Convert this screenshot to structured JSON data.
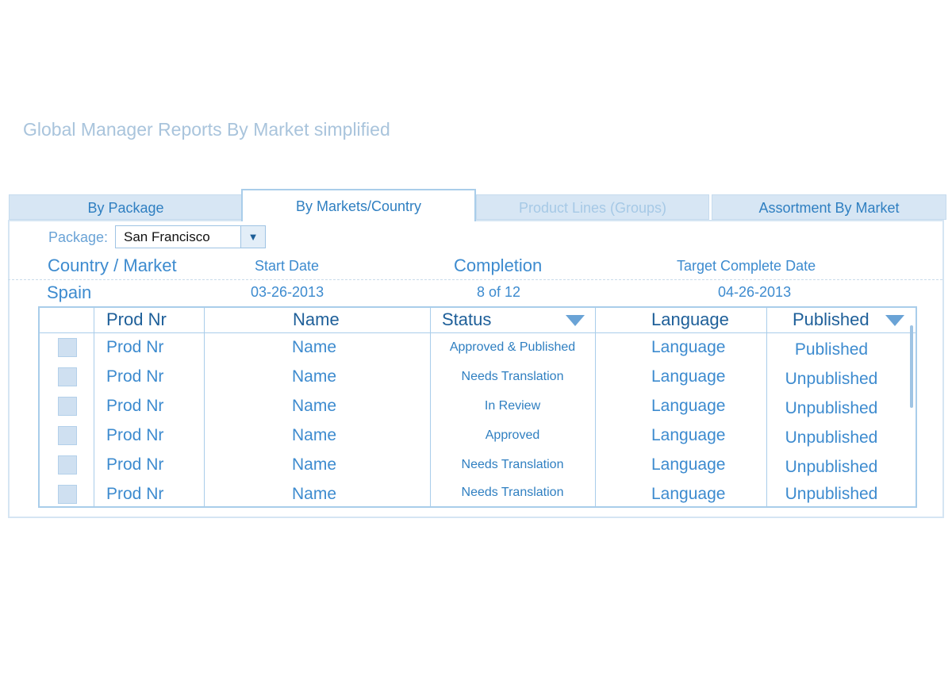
{
  "page": {
    "title": "Global Manager Reports By Market simplified"
  },
  "tabs": [
    {
      "label": "By Package"
    },
    {
      "label": "By Markets/Country"
    },
    {
      "label": "Product Lines (Groups)"
    },
    {
      "label": "Assortment By Market"
    }
  ],
  "filter": {
    "label": "Package:",
    "selected": "San Francisco"
  },
  "summary": {
    "headers": {
      "country": "Country / Market",
      "start_date": "Start Date",
      "completion": "Completion",
      "target_date": "Target Complete Date"
    },
    "values": {
      "country": "Spain",
      "start_date": "03-26-2013",
      "completion": "8 of 12",
      "target_date": "04-26-2013"
    }
  },
  "table": {
    "columns": {
      "prod_nr": "Prod Nr",
      "name": "Name",
      "status": "Status",
      "language": "Language",
      "published": "Published"
    },
    "rows": [
      {
        "prod_nr": "Prod Nr",
        "name": "Name",
        "status": "Approved & Published",
        "language": "Language",
        "published": "Published"
      },
      {
        "prod_nr": "Prod Nr",
        "name": "Name",
        "status": "Needs Translation",
        "language": "Language",
        "published": "Unpublished"
      },
      {
        "prod_nr": "Prod Nr",
        "name": "Name",
        "status": "In Review",
        "language": "Language",
        "published": "Unpublished"
      },
      {
        "prod_nr": "Prod Nr",
        "name": "Name",
        "status": "Approved",
        "language": "Language",
        "published": "Unpublished"
      },
      {
        "prod_nr": "Prod Nr",
        "name": "Name",
        "status": "Needs Translation",
        "language": "Language",
        "published": "Unpublished"
      },
      {
        "prod_nr": "Prod Nr",
        "name": "Name",
        "status": "Needs Translation",
        "language": "Language",
        "published": "Unpublished"
      }
    ]
  },
  "icons": {
    "dropdown": "chevron-down-icon",
    "status_filter": "filter-dropdown-icon",
    "published_filter": "filter-dropdown-icon"
  },
  "colors": {
    "accent": "#2f7fc1",
    "tab_background": "#d7e6f4",
    "border": "#a9cdea",
    "title": "#a9c4dc"
  }
}
